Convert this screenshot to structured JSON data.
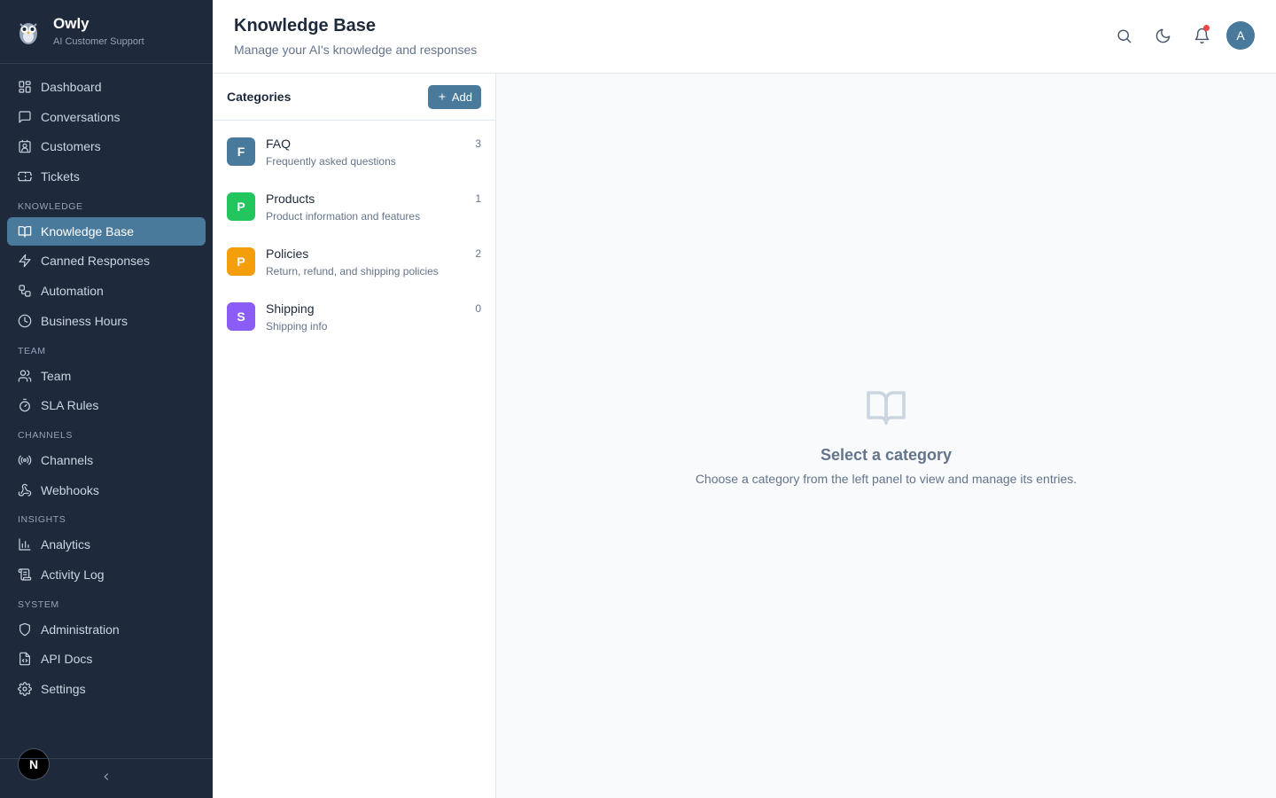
{
  "brand": {
    "name": "Owly",
    "subtitle": "AI Customer Support"
  },
  "sidebar": {
    "main_items": [
      {
        "label": "Dashboard",
        "icon": "dashboard-icon"
      },
      {
        "label": "Conversations",
        "icon": "message-icon"
      },
      {
        "label": "Customers",
        "icon": "contact-icon"
      },
      {
        "label": "Tickets",
        "icon": "ticket-icon"
      }
    ],
    "sections": [
      {
        "label": "KNOWLEDGE",
        "items": [
          {
            "label": "Knowledge Base",
            "icon": "book-icon",
            "active": true
          },
          {
            "label": "Canned Responses",
            "icon": "zap-icon"
          },
          {
            "label": "Automation",
            "icon": "workflow-icon"
          },
          {
            "label": "Business Hours",
            "icon": "clock-icon"
          }
        ]
      },
      {
        "label": "TEAM",
        "items": [
          {
            "label": "Team",
            "icon": "users-icon"
          },
          {
            "label": "SLA Rules",
            "icon": "timer-icon"
          }
        ]
      },
      {
        "label": "CHANNELS",
        "items": [
          {
            "label": "Channels",
            "icon": "radio-icon"
          },
          {
            "label": "Webhooks",
            "icon": "webhook-icon"
          }
        ]
      },
      {
        "label": "INSIGHTS",
        "items": [
          {
            "label": "Analytics",
            "icon": "bar-chart-icon"
          },
          {
            "label": "Activity Log",
            "icon": "scroll-icon"
          }
        ]
      },
      {
        "label": "SYSTEM",
        "items": [
          {
            "label": "Administration",
            "icon": "shield-icon"
          },
          {
            "label": "API Docs",
            "icon": "file-code-icon"
          },
          {
            "label": "Settings",
            "icon": "gear-icon"
          }
        ]
      }
    ],
    "badge_letter": "N"
  },
  "header": {
    "title": "Knowledge Base",
    "subtitle": "Manage your AI's knowledge and responses",
    "avatar_initial": "A"
  },
  "categories": {
    "title": "Categories",
    "add_label": "Add",
    "items": [
      {
        "letter": "F",
        "name": "FAQ",
        "description": "Frequently asked questions",
        "count": "3",
        "color": "#4a7a9b"
      },
      {
        "letter": "P",
        "name": "Products",
        "description": "Product information and features",
        "count": "1",
        "color": "#22c55e"
      },
      {
        "letter": "P",
        "name": "Policies",
        "description": "Return, refund, and shipping policies",
        "count": "2",
        "color": "#f59e0b"
      },
      {
        "letter": "S",
        "name": "Shipping",
        "description": "Shipping info",
        "count": "0",
        "color": "#8b5cf6"
      }
    ]
  },
  "empty_state": {
    "title": "Select a category",
    "message": "Choose a category from the left panel to view and manage its entries."
  }
}
